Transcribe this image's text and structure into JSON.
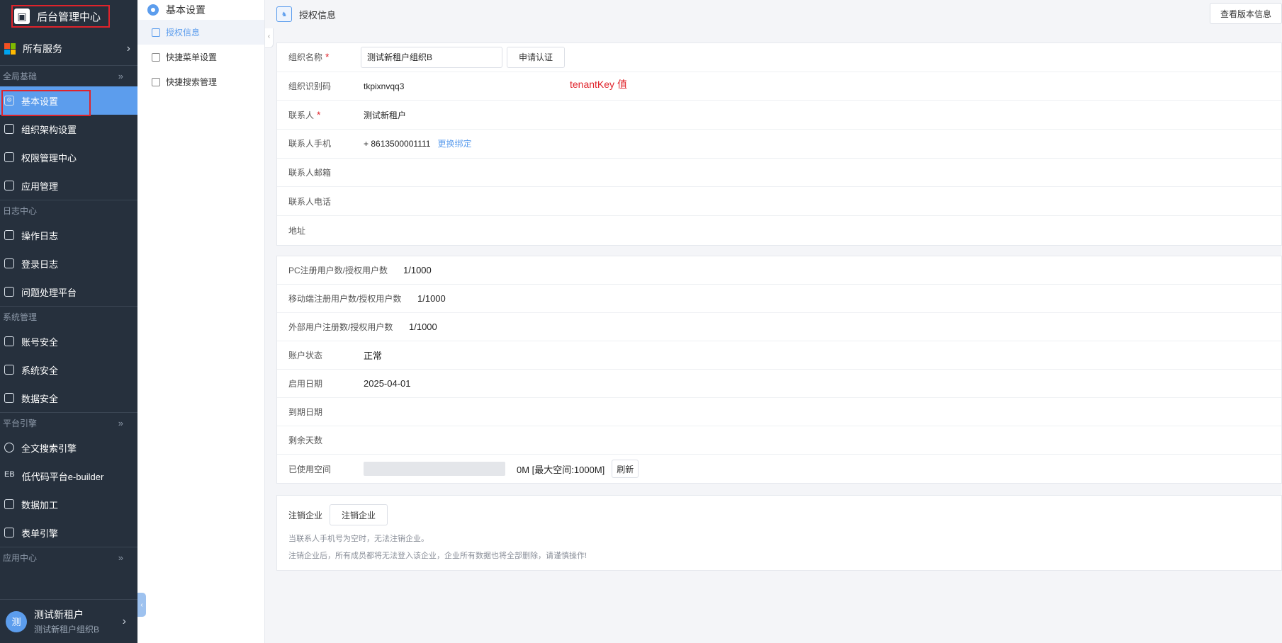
{
  "sidebar": {
    "app_title": "后台管理中心",
    "all_services": "所有服务",
    "sections": [
      {
        "title": "全局基础",
        "items": [
          "基本设置",
          "组织架构设置",
          "权限管理中心",
          "应用管理"
        ]
      },
      {
        "title": "日志中心",
        "items": [
          "操作日志",
          "登录日志",
          "问题处理平台"
        ]
      },
      {
        "title": "系统管理",
        "items": [
          "账号安全",
          "系统安全",
          "数据安全"
        ]
      },
      {
        "title": "平台引擎",
        "items": [
          "全文搜索引擎",
          "低代码平台e-builder",
          "数据加工",
          "表单引擎"
        ]
      },
      {
        "title": "应用中心",
        "items": []
      }
    ],
    "eb_prefix": "EB",
    "user": {
      "avatar": "测",
      "name": "测试新租户",
      "org": "测试新租户组织B"
    }
  },
  "submenu": {
    "title": "基本设置",
    "items": [
      "授权信息",
      "快捷菜单设置",
      "快捷搜索管理"
    ]
  },
  "topbar": {
    "title": "授权信息",
    "version_button": "查看版本信息"
  },
  "org_info": {
    "org_name_label": "组织名称",
    "org_name_value": "测试新租户组织B",
    "apply_button": "申请认证",
    "org_code_label": "组织识别码",
    "org_code_value": "tkpixnvqq3",
    "annotation": "tenantKey 值",
    "contact_label": "联系人",
    "contact_value": "测试新租户",
    "phone_label": "联系人手机",
    "phone_value": "+ 8613500001111",
    "change_link": "更换绑定",
    "email_label": "联系人邮箱",
    "tel_label": "联系人电话",
    "address_label": "地址"
  },
  "license": {
    "pc_label": "PC注册用户数/授权用户数",
    "pc_value": "1/1000",
    "mobile_label": "移动端注册用户数/授权用户数",
    "mobile_value": "1/1000",
    "external_label": "外部用户注册数/授权用户数",
    "external_value": "1/1000",
    "status_label": "账户状态",
    "status_value": "正常",
    "start_label": "启用日期",
    "start_value": "2025-04-01",
    "expire_label": "到期日期",
    "remaining_label": "剩余天数",
    "space_label": "已使用空间",
    "space_used_fraction": 0,
    "space_value": "0M [最大空间:1000M]",
    "refresh_button": "刷新"
  },
  "cancel": {
    "label": "注销企业",
    "button": "注销企业",
    "note1": "当联系人手机号为空时，无法注销企业。",
    "note2": "注销企业后，所有成员都将无法登入该企业，企业所有数据也将全部删除，请谨慎操作!"
  },
  "colors": {
    "accent": "#5c9ded",
    "sidebar_bg": "#26303d",
    "annotation": "#e0232b"
  }
}
